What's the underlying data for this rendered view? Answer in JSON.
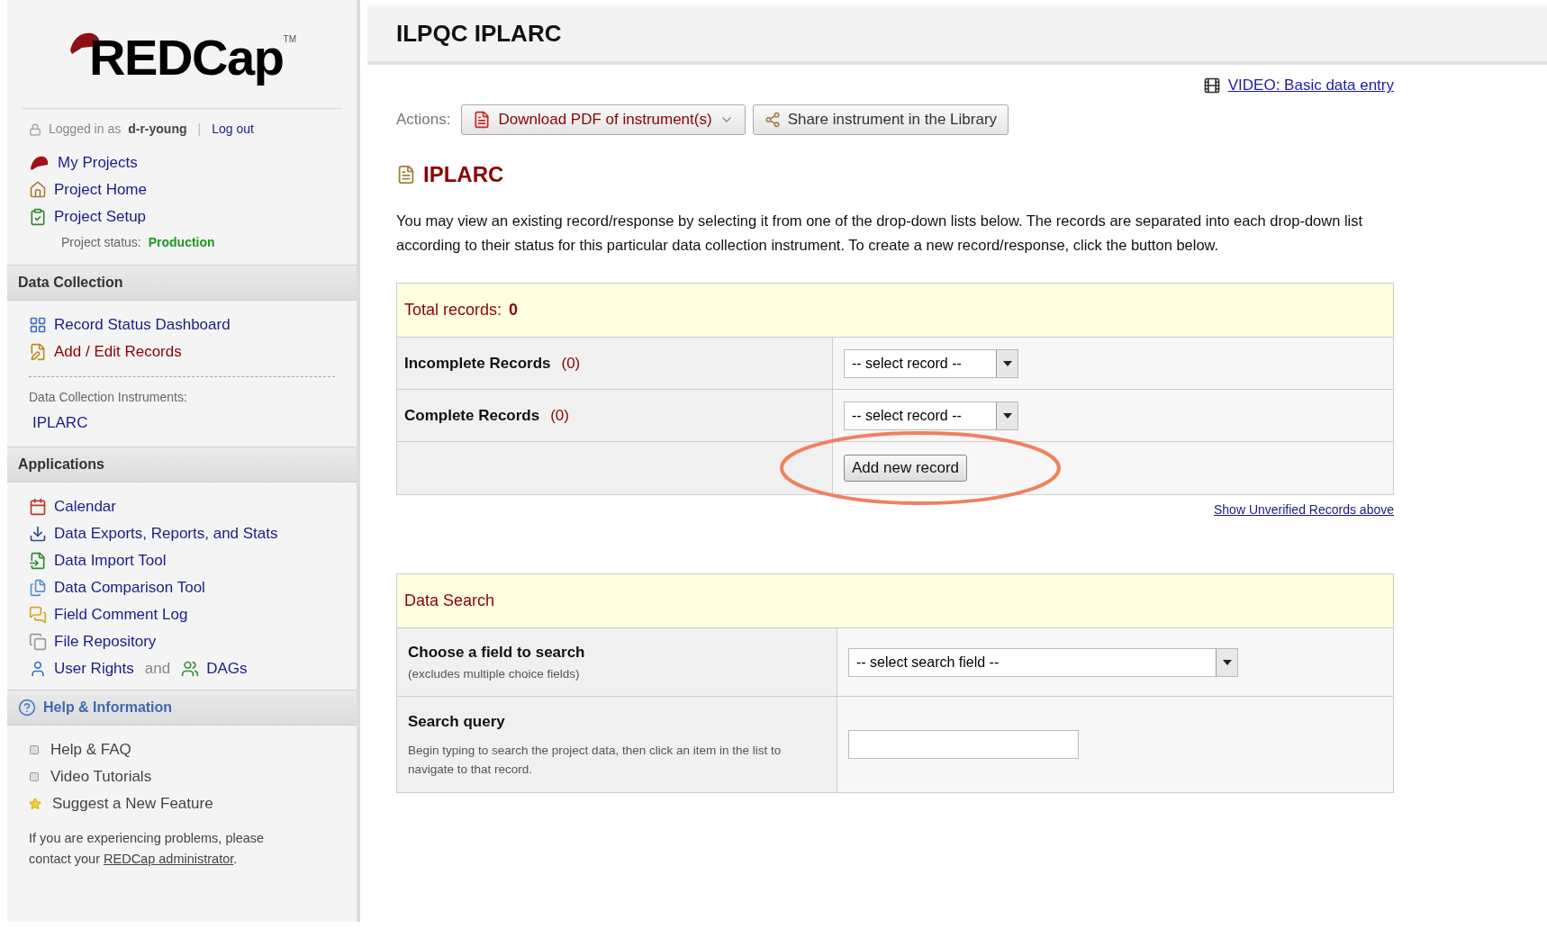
{
  "logo": {
    "text": "REDCap",
    "mark": "TM"
  },
  "login": {
    "prefix": "Logged in as",
    "user": "d-r-young",
    "separator": "|",
    "logout": "Log out"
  },
  "project_links": [
    {
      "label": "My Projects"
    },
    {
      "label": "Project Home"
    },
    {
      "label": "Project Setup"
    }
  ],
  "project_status": {
    "label": "Project status:",
    "value": "Production"
  },
  "data_collection": {
    "title": "Data Collection",
    "items": [
      {
        "label": "Record Status Dashboard",
        "selected": false
      },
      {
        "label": "Add / Edit Records",
        "selected": true
      }
    ],
    "instruments_label": "Data Collection Instruments:",
    "instruments": [
      {
        "label": "IPLARC"
      }
    ]
  },
  "applications": {
    "title": "Applications",
    "items": [
      {
        "kind": "link",
        "label": "Calendar"
      },
      {
        "kind": "link",
        "label": "Data Exports, Reports, and Stats"
      },
      {
        "kind": "link",
        "label": "Data Import Tool"
      },
      {
        "kind": "link",
        "label": "Data Comparison Tool"
      },
      {
        "kind": "link",
        "label": "Field Comment Log"
      },
      {
        "kind": "link",
        "label": "File Repository"
      },
      {
        "kind": "pair",
        "label": "User Rights",
        "joiner": "and",
        "label2": "DAGs"
      }
    ]
  },
  "help": {
    "title": "Help & Information",
    "items": [
      {
        "kind": "bullet",
        "label": "Help & FAQ"
      },
      {
        "kind": "bullet",
        "label": "Video Tutorials"
      },
      {
        "kind": "star",
        "label": "Suggest a New Feature"
      }
    ],
    "note": "If you are experiencing problems, please contact your",
    "note_link": "REDCap administrator",
    "note_end": "."
  },
  "page_title": "ILPQC IPLARC",
  "video_link": "VIDEO: Basic data entry",
  "actions": {
    "label": "Actions:",
    "buttons": [
      {
        "kind": "pdf",
        "label": "Download PDF of instrument(s)"
      },
      {
        "kind": "share",
        "label": "Share instrument in the Library"
      }
    ]
  },
  "instrument_title": "IPLARC",
  "intro": "You may view an existing record/response by selecting it from one of the drop-down lists below. The records are separated into each drop-down list according to their status for this particular data collection instrument. To create a new record/response, click the button below.",
  "records": {
    "label": "Total records:",
    "total": "0",
    "rows": [
      {
        "label": "Incomplete Records",
        "count": "(0)",
        "value": "-- select record --"
      },
      {
        "label": "Complete Records",
        "count": "(0)",
        "value": "-- select record --"
      }
    ],
    "add_button": "Add new record",
    "unverified_link": "Show Unverified Records above"
  },
  "search": {
    "title": "Data Search",
    "rows": [
      {
        "kind": "select",
        "label": "Choose a field to search",
        "hint": "(excludes multiple choice fields)",
        "value": "-- select search field --"
      },
      {
        "kind": "text",
        "label": "Search query",
        "hint": "Begin typing to search the project data, then click an item in the list to navigate to that record."
      }
    ]
  }
}
